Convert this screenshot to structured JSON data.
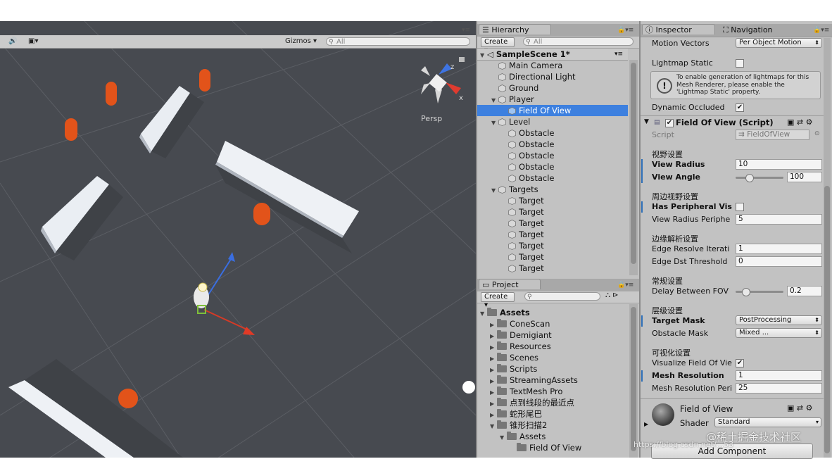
{
  "scene": {
    "gizmos_label": "Gizmos",
    "search_placeholder": "All",
    "persp_label": "Persp",
    "axis_z": "z",
    "axis_x": "x"
  },
  "hierarchy": {
    "tab_label": "Hierarchy",
    "create_label": "Create",
    "search_placeholder": "All",
    "scene_name": "SampleScene 1*",
    "items": [
      {
        "label": "Main Camera"
      },
      {
        "label": "Directional Light"
      },
      {
        "label": "Ground"
      },
      {
        "label": "Player"
      },
      {
        "label": "Field Of View"
      },
      {
        "label": "Level"
      },
      {
        "label": "Obstacle"
      },
      {
        "label": "Obstacle"
      },
      {
        "label": "Obstacle"
      },
      {
        "label": "Obstacle"
      },
      {
        "label": "Obstacle"
      },
      {
        "label": "Targets"
      },
      {
        "label": "Target"
      },
      {
        "label": "Target"
      },
      {
        "label": "Target"
      },
      {
        "label": "Target"
      },
      {
        "label": "Target"
      },
      {
        "label": "Target"
      },
      {
        "label": "Target"
      }
    ]
  },
  "project": {
    "tab_label": "Project",
    "create_label": "Create",
    "root": "Assets",
    "items": [
      {
        "label": "ConeScan"
      },
      {
        "label": "Demigiant"
      },
      {
        "label": "Resources"
      },
      {
        "label": "Scenes"
      },
      {
        "label": "Scripts"
      },
      {
        "label": "StreamingAssets"
      },
      {
        "label": "TextMesh Pro"
      },
      {
        "label": "点到线段的最近点"
      },
      {
        "label": "蛇形尾巴"
      },
      {
        "label": "锥形扫描2"
      },
      {
        "label": "Assets"
      },
      {
        "label": "Field Of View"
      }
    ]
  },
  "inspector": {
    "tab_label": "Inspector",
    "nav_tab_label": "Navigation",
    "motion_vectors_label": "Motion Vectors",
    "motion_vectors_value": "Per Object Motion",
    "lightmap_static_label": "Lightmap Static",
    "lightmap_info": "To enable generation of lightmaps for this Mesh Renderer, please enable the 'Lightmap Static' property.",
    "dynamic_occluded_label": "Dynamic Occluded",
    "component_title": "Field Of View (Script)",
    "script_label": "Script",
    "script_value": "FieldOfView",
    "sec_view": "视野设置",
    "view_radius_label": "View Radius",
    "view_radius_value": "10",
    "view_angle_label": "View Angle",
    "view_angle_value": "100",
    "view_angle_fraction": 0.28,
    "sec_peripheral": "周边视野设置",
    "has_peripheral_label": "Has Peripheral Vis",
    "view_radius_peri_label": "View Radius Periphe",
    "view_radius_peri_value": "5",
    "sec_edge": "边缘解析设置",
    "edge_resolve_label": "Edge Resolve Iterati",
    "edge_resolve_value": "1",
    "edge_dst_label": "Edge Dst Threshold",
    "edge_dst_value": "0",
    "sec_general": "常规设置",
    "delay_label": "Delay Between FOV",
    "delay_value": "0.2",
    "delay_fraction": 0.2,
    "sec_layers": "层级设置",
    "target_mask_label": "Target Mask",
    "target_mask_value": "PostProcessing",
    "obstacle_mask_label": "Obstacle Mask",
    "obstacle_mask_value": "Mixed ...",
    "sec_vis": "可视化设置",
    "visualize_label": "Visualize Field Of Vie",
    "mesh_res_label": "Mesh Resolution",
    "mesh_res_value": "1",
    "mesh_res_peri_label": "Mesh Resolution Peri",
    "mesh_res_peri_value": "25",
    "material_name": "Field of View",
    "shader_label": "Shader",
    "shader_value": "Standard",
    "add_component_label": "Add Component"
  },
  "watermark": "@稀土掘金技术社区",
  "watermark_url": "https://blog.csdn.net/...53"
}
